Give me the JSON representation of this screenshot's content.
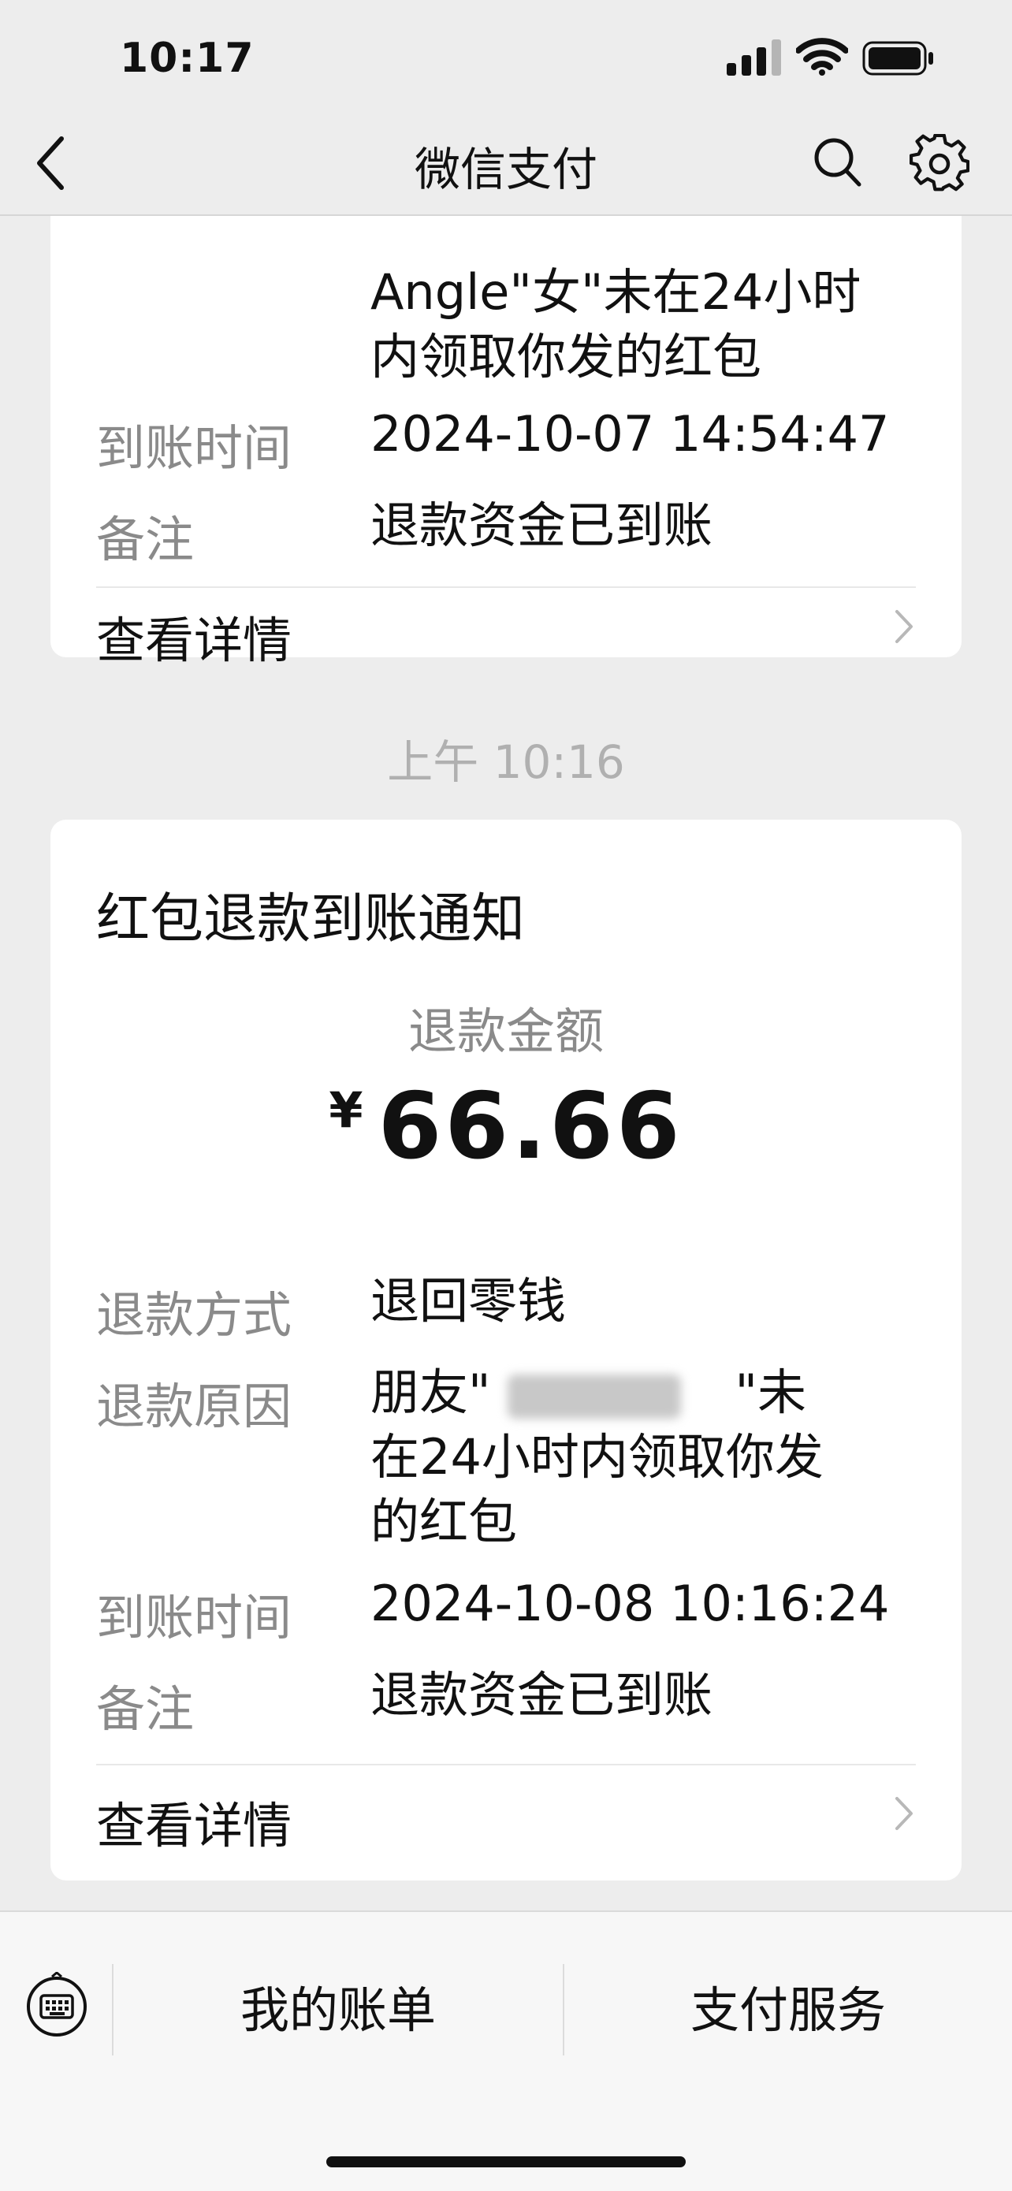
{
  "status_bar": {
    "time": "10:17"
  },
  "nav": {
    "title": "微信支付",
    "back_icon": "chevron-left-icon",
    "search_icon": "search-icon",
    "settings_icon": "gear-icon"
  },
  "card1": {
    "reason_line_1": "Angle\"女\"未在24小时",
    "reason_line_2": "内领取你发的红包",
    "arrival_label": "到账时间",
    "arrival_value": "2024-10-07 14:54:47",
    "note_label": "备注",
    "note_value": "退款资金已到账",
    "detail_link": "查看详情"
  },
  "timestamp": "上午 10:16",
  "card2": {
    "title": "红包退款到账通知",
    "amount_label": "退款金额",
    "currency": "¥",
    "amount": "66.66",
    "method_label": "退款方式",
    "method_value": "退回零钱",
    "reason_label": "退款原因",
    "reason_line_1": "朋友\"　　　　　\"未",
    "reason_line_2": "在24小时内领取你发",
    "reason_line_3": "的红包",
    "arrival_label": "到账时间",
    "arrival_value": "2024-10-08 10:16:24",
    "note_label": "备注",
    "note_value": "退款资金已到账",
    "detail_link": "查看详情"
  },
  "bottom_bar": {
    "keyboard_icon": "keyboard-icon",
    "my_bills": "我的账单",
    "pay_services": "支付服务"
  }
}
